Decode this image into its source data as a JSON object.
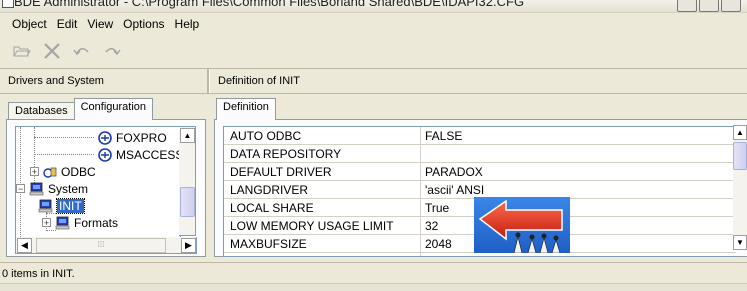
{
  "window": {
    "title": "BDE Administrator - C:\\Program Files\\Common Files\\Borland Shared\\BDE\\IDAPI32.CFG"
  },
  "menu": [
    "Object",
    "Edit",
    "View",
    "Options",
    "Help"
  ],
  "toolbar": {
    "icons": [
      "open-icon",
      "delete-icon",
      "undo-icon",
      "redo-icon"
    ]
  },
  "left": {
    "header": "Drivers and System",
    "tabs": [
      "Databases",
      "Configuration"
    ],
    "active_tab": "Configuration",
    "tree": {
      "items": [
        {
          "label": "FOXPRO",
          "icon": "driver-icon"
        },
        {
          "label": "MSACCESS",
          "icon": "driver-icon"
        },
        {
          "label": "ODBC",
          "icon": "odbc-icon",
          "expander": "+"
        },
        {
          "label": "System",
          "icon": "computer-icon",
          "expander": "−"
        },
        {
          "label": "INIT",
          "icon": "init-icon",
          "selected": true
        },
        {
          "label": "Formats",
          "icon": "formats-icon",
          "expander": "+"
        }
      ]
    }
  },
  "right": {
    "header": "Definition of INIT",
    "tab": "Definition",
    "rows": [
      {
        "key": "AUTO ODBC",
        "value": "FALSE"
      },
      {
        "key": "DATA REPOSITORY",
        "value": ""
      },
      {
        "key": "DEFAULT DRIVER",
        "value": "PARADOX"
      },
      {
        "key": "LANGDRIVER",
        "value": "'ascii' ANSI"
      },
      {
        "key": "LOCAL SHARE",
        "value": "True"
      },
      {
        "key": "LOW MEMORY USAGE LIMIT",
        "value": "32"
      },
      {
        "key": "MAXBUFSIZE",
        "value": "2048"
      }
    ]
  },
  "status": {
    "text": "0 items in INIT."
  },
  "colors": {
    "selection": "#316ac5",
    "window_bg": "#ece9d8",
    "arrow_red": "#e8381e",
    "sign_blue": "#1f6fd6"
  }
}
